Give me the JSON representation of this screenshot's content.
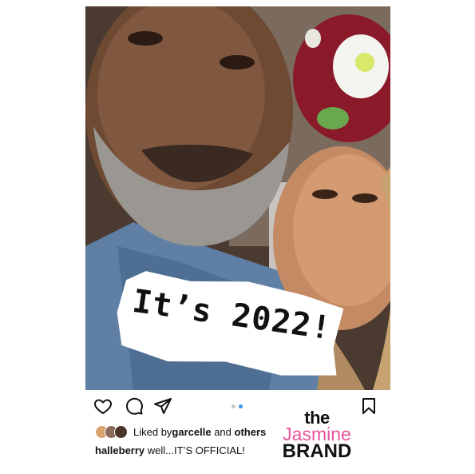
{
  "post": {
    "overlay_text": "It’s 2022!",
    "liked": {
      "prefix": "Liked by ",
      "user": "garcelle",
      "middle": " and ",
      "others": "others"
    },
    "caption": {
      "username": "halleberry",
      "text": " well...IT’S OFFICIAL!"
    },
    "carousel": {
      "count": 2,
      "active_index": 1
    }
  },
  "actions": {
    "like_icon": "heart-icon",
    "comment_icon": "comment-icon",
    "share_icon": "paper-plane-icon",
    "save_icon": "bookmark-icon"
  },
  "watermark": {
    "line1": "the",
    "line2": "Jasmine",
    "line3": "BRAND"
  },
  "colors": {
    "brand_pink": "#e6559b",
    "dot_active": "#3897f0",
    "dot_inactive": "#c7c7c7"
  }
}
